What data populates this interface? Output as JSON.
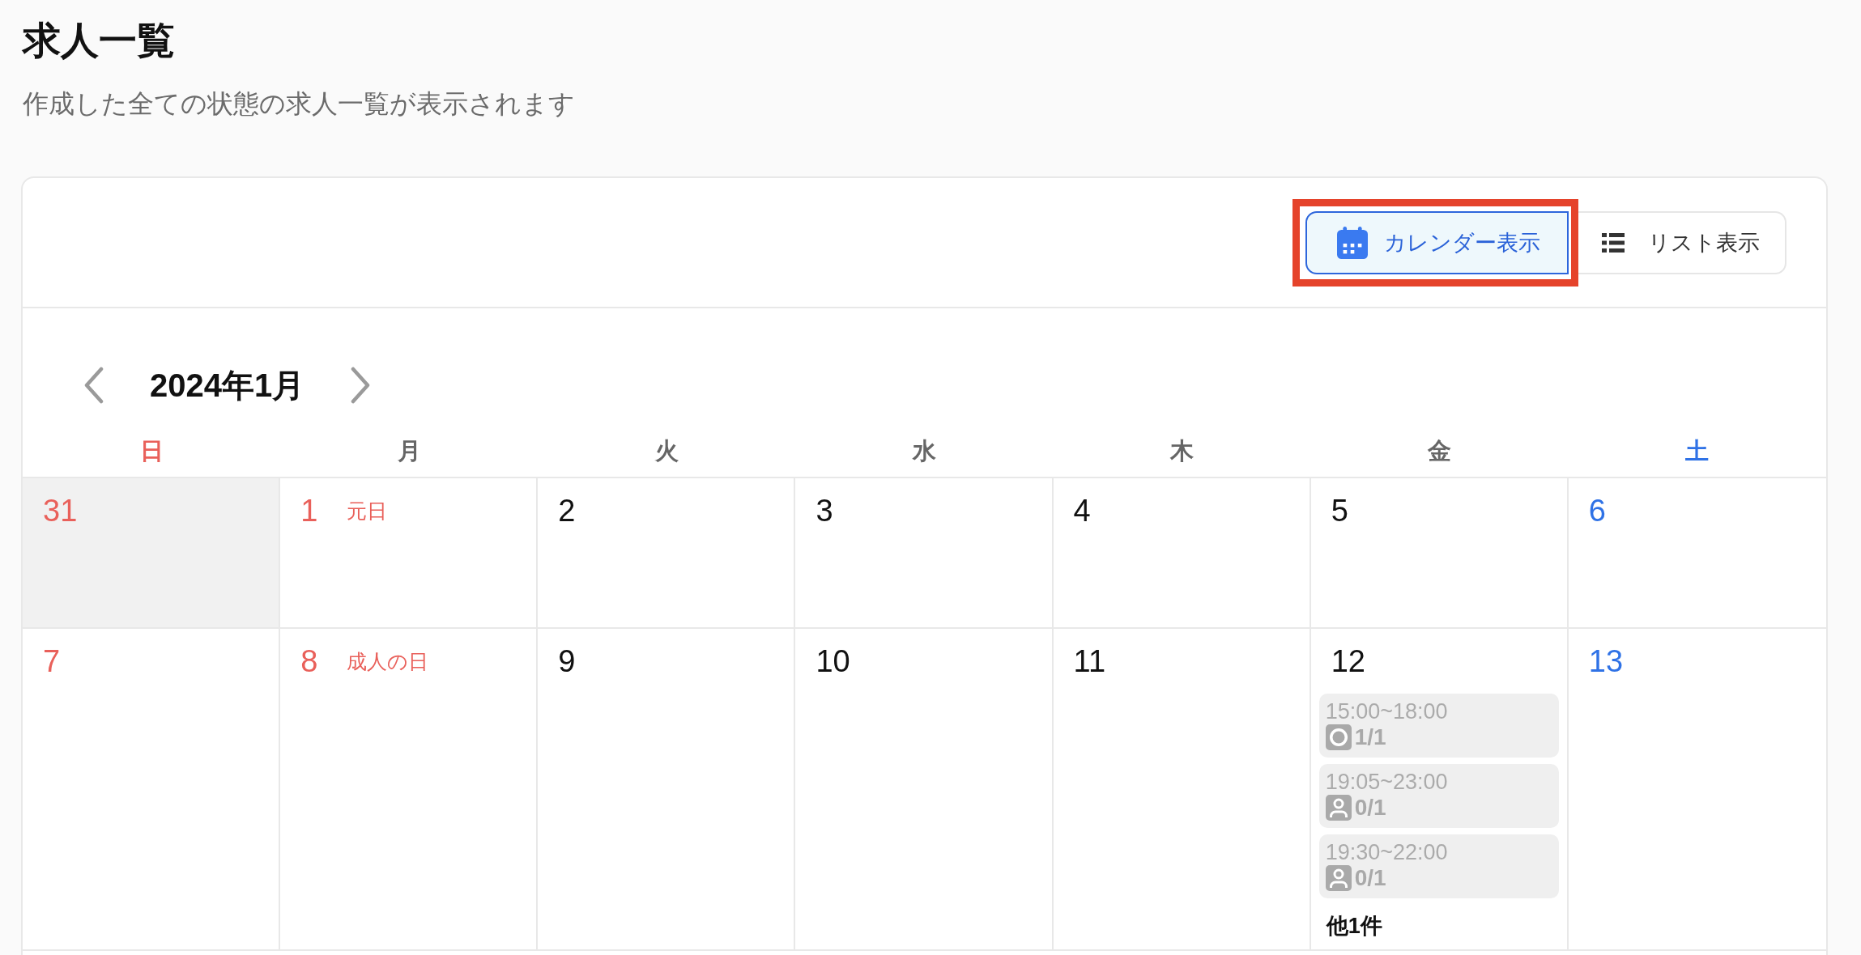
{
  "page": {
    "title": "求人一覧",
    "subtitle": "作成した全ての状態の求人一覧が表示されます"
  },
  "view_toggle": [
    {
      "label": "カレンダー表示",
      "kind": "calendar",
      "selected": true,
      "highlighted": true
    },
    {
      "label": "リスト表示",
      "kind": "list",
      "selected": false,
      "highlighted": false
    }
  ],
  "calendar": {
    "month_label": "2024年1月",
    "weekdays": [
      {
        "label": "日",
        "kind": "sunday"
      },
      {
        "label": "月",
        "kind": "weekday"
      },
      {
        "label": "火",
        "kind": "weekday"
      },
      {
        "label": "水",
        "kind": "weekday"
      },
      {
        "label": "木",
        "kind": "weekday"
      },
      {
        "label": "金",
        "kind": "weekday"
      },
      {
        "label": "土",
        "kind": "saturday"
      }
    ],
    "weeks": [
      {
        "days": [
          {
            "date": "31",
            "kind": "sunday",
            "outside_month": true
          },
          {
            "date": "1",
            "kind": "holiday",
            "holiday": "元日",
            "outside_month": false
          },
          {
            "date": "2",
            "kind": "weekday",
            "outside_month": false
          },
          {
            "date": "3",
            "kind": "weekday",
            "outside_month": false
          },
          {
            "date": "4",
            "kind": "weekday",
            "outside_month": false
          },
          {
            "date": "5",
            "kind": "weekday",
            "outside_month": false
          },
          {
            "date": "6",
            "kind": "saturday",
            "outside_month": false
          }
        ]
      },
      {
        "days": [
          {
            "date": "7",
            "kind": "sunday",
            "outside_month": false
          },
          {
            "date": "8",
            "kind": "holiday",
            "holiday": "成人の日",
            "outside_month": false
          },
          {
            "date": "9",
            "kind": "weekday",
            "outside_month": false
          },
          {
            "date": "10",
            "kind": "weekday",
            "outside_month": false
          },
          {
            "date": "11",
            "kind": "weekday",
            "outside_month": false
          },
          {
            "date": "12",
            "kind": "weekday",
            "outside_month": false,
            "events": [
              {
                "time": "15:00~18:00",
                "kind": "ring",
                "count": "1/1"
              },
              {
                "time": "19:05~23:00",
                "kind": "person",
                "count": "0/1"
              },
              {
                "time": "19:30~22:00",
                "kind": "person",
                "count": "0/1"
              }
            ],
            "more": "他1件"
          },
          {
            "date": "13",
            "kind": "saturday",
            "outside_month": false
          }
        ]
      }
    ]
  }
}
